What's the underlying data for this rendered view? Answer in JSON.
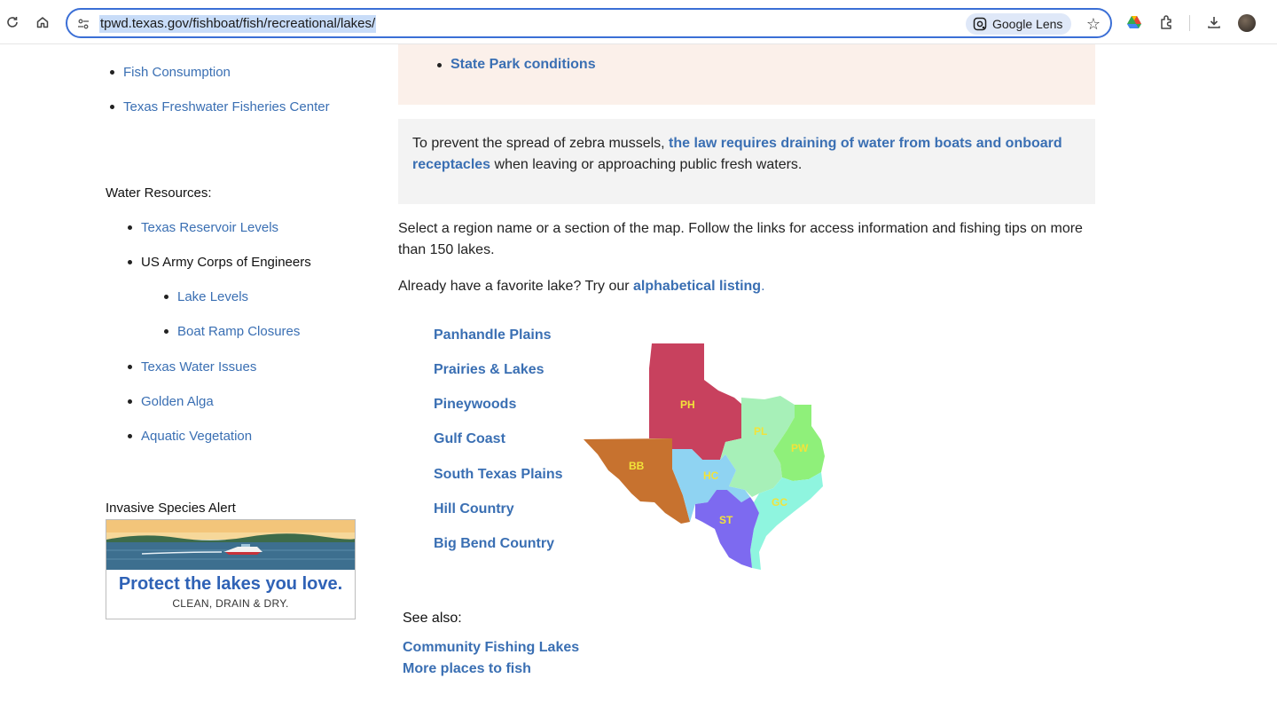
{
  "browser": {
    "url": "tpwd.texas.gov/fishboat/fish/recreational/lakes/",
    "lens_label": "Google Lens"
  },
  "sidebar": {
    "top_links": [
      "Fish Consumption",
      "Texas Freshwater Fisheries Center"
    ],
    "water_heading": "Water Resources:",
    "water_items": {
      "reservoir": "Texas Reservoir Levels",
      "corps": "US Army Corps of Engineers",
      "lake_levels": "Lake Levels",
      "ramp": "Boat Ramp Closures",
      "issues": "Texas Water Issues",
      "alga": "Golden Alga",
      "vegetation": "Aquatic Vegetation"
    },
    "invasive_heading": "Invasive Species Alert",
    "ad": {
      "title": "Protect the lakes you love.",
      "subtitle": "CLEAN, DRAIN & DRY."
    }
  },
  "main": {
    "state_park_link": "State Park conditions",
    "mussel": {
      "before": "To prevent the spread of zebra mussels, ",
      "link": "the law requires draining of water from boats and onboard receptacles",
      "after": " when leaving or approaching public fresh waters."
    },
    "select_text": "Select a region name or a section of the map. Follow the links for access information and fishing tips on more than 150 lakes.",
    "favorite": {
      "before": "Already have a favorite lake? Try our ",
      "link": "alphabetical listing",
      "after": "."
    },
    "regions": [
      "Panhandle Plains",
      "Prairies & Lakes",
      "Pineywoods",
      "Gulf Coast",
      "South Texas Plains",
      "Hill Country",
      "Big Bend Country"
    ],
    "map_labels": {
      "ph": "PH",
      "pl": "PL",
      "pw": "PW",
      "bb": "BB",
      "hc": "HC",
      "gc": "GC",
      "st": "ST"
    },
    "map_colors": {
      "ph": "#c8415e",
      "pl": "#a7f0b8",
      "pw": "#8ff07a",
      "bb": "#c7722f",
      "hc": "#8fd3f2",
      "gc": "#8ff5df",
      "st": "#7d6af0",
      "label": "#f2e33a"
    },
    "see_also": {
      "heading": "See also:",
      "links": [
        "Community Fishing Lakes",
        "More places to fish"
      ]
    }
  }
}
